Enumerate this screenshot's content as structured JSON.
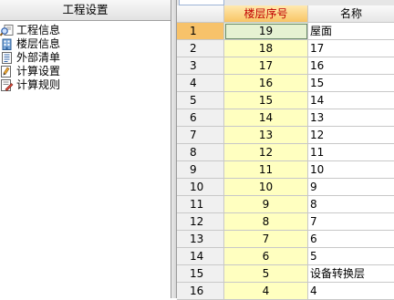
{
  "left_panel": {
    "title": "工程设置",
    "items": [
      {
        "label": "工程信息",
        "icon": "magnifier-doc-icon"
      },
      {
        "label": "楼层信息",
        "icon": "building-icon"
      },
      {
        "label": "外部清单",
        "icon": "list-doc-icon"
      },
      {
        "label": "计算设置",
        "icon": "settings-icon"
      },
      {
        "label": "计算规则",
        "icon": "rules-icon"
      }
    ]
  },
  "grid": {
    "columns": [
      "",
      "楼层序号",
      "名称"
    ],
    "active_row": 1,
    "rows": [
      {
        "num": "1",
        "floor": "19",
        "name": "屋面"
      },
      {
        "num": "2",
        "floor": "18",
        "name": "17"
      },
      {
        "num": "3",
        "floor": "17",
        "name": "16"
      },
      {
        "num": "4",
        "floor": "16",
        "name": "15"
      },
      {
        "num": "5",
        "floor": "15",
        "name": "14"
      },
      {
        "num": "6",
        "floor": "14",
        "name": "13"
      },
      {
        "num": "7",
        "floor": "13",
        "name": "12"
      },
      {
        "num": "8",
        "floor": "12",
        "name": "11"
      },
      {
        "num": "9",
        "floor": "11",
        "name": "10"
      },
      {
        "num": "10",
        "floor": "10",
        "name": "9"
      },
      {
        "num": "11",
        "floor": "9",
        "name": "8"
      },
      {
        "num": "12",
        "floor": "8",
        "name": "7"
      },
      {
        "num": "13",
        "floor": "7",
        "name": "6"
      },
      {
        "num": "14",
        "floor": "6",
        "name": "5"
      },
      {
        "num": "15",
        "floor": "5",
        "name": "设备转换层"
      },
      {
        "num": "16",
        "floor": "4",
        "name": "4"
      }
    ]
  },
  "colors": {
    "floor_column_bg": "#ffffc0",
    "floor_header_text": "#c00000",
    "active_row_header": "#f7c26a"
  }
}
